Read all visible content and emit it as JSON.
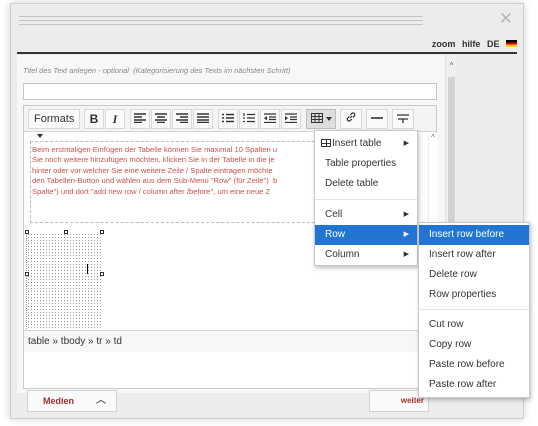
{
  "topbar": {
    "zoom": "zoom",
    "help": "hilfe",
    "lang": "DE"
  },
  "form": {
    "title_placeholder": "Titel des Text anlegen - optional  (Kategorisierung des Texts im nächsten Schritt)"
  },
  "toolbar": {
    "formats": "Formats"
  },
  "content": {
    "lines": [
      "Beim erstmaligen Einfügen der Tabelle können Sie maximal 10 Spalten u",
      "Sie noch weitere hinzufügen möchten, klicken Sie in der Tabelle in die je",
      "hinter oder vor welcher Sie eine weitere Zeile / Spalte eintragen möchte",
      "den Tabellen-Button und wählen aus dem Sub-Menü \"Row\" (für Zeile\")  b",
      "Spalte\") und dort \"add new row / column after /before\", um eine neue Z"
    ]
  },
  "statusbar": {
    "path": "table » tbody » tr » td"
  },
  "bottom": {
    "media_label": "Medien",
    "next_label": "weiter"
  },
  "table_menu": {
    "insert_table": "Insert table",
    "table_properties": "Table properties",
    "delete_table": "Delete table",
    "cell": "Cell",
    "row": "Row",
    "column": "Column"
  },
  "row_menu": {
    "insert_before": "Insert row before",
    "insert_after": "Insert row after",
    "delete_row": "Delete row",
    "row_properties": "Row properties",
    "cut_row": "Cut row",
    "copy_row": "Copy row",
    "paste_before": "Paste row before",
    "paste_after": "Paste row after"
  },
  "colors": {
    "highlight": "#2276d2",
    "content_text": "#d05050",
    "accent_red": "#a03030"
  },
  "icons": [
    "close-icon",
    "flag-icon",
    "bold-icon",
    "italic-icon",
    "align-left-icon",
    "align-center-icon",
    "align-right-icon",
    "align-justify-icon",
    "bullet-list-icon",
    "numbered-list-icon",
    "outdent-icon",
    "indent-icon",
    "table-icon",
    "link-icon",
    "horizontal-rule-icon",
    "page-break-icon"
  ]
}
